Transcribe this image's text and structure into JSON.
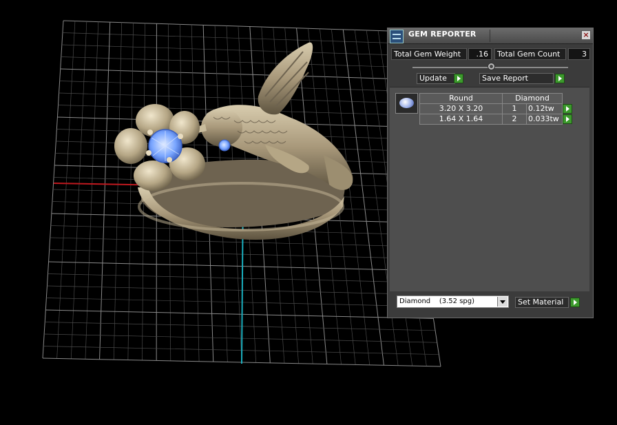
{
  "panel": {
    "title": "GEM REPORTER",
    "close": "×",
    "total_weight_label": "Total Gem Weight",
    "total_weight_value": ".16",
    "total_count_label": "Total Gem Count",
    "total_count_value": "3",
    "update_label": "Update",
    "save_report_label": "Save Report",
    "table": {
      "headers": [
        "Round",
        "Diamond"
      ],
      "rows": [
        {
          "size": "3.20 X 3.20",
          "qty": "1",
          "weight": "0.12tw"
        },
        {
          "size": "1.64 X 1.64",
          "qty": "2",
          "weight": "0.033tw"
        }
      ]
    },
    "material_value": "Diamond    (3.52 spg)",
    "set_material_label": "Set Material"
  },
  "colors": {
    "accent_green": "#3c9a2c",
    "x_axis": "#c0191f",
    "y_axis": "#1ab0c0",
    "metal": "#a89a7a",
    "gem": "#7aa6ff"
  }
}
